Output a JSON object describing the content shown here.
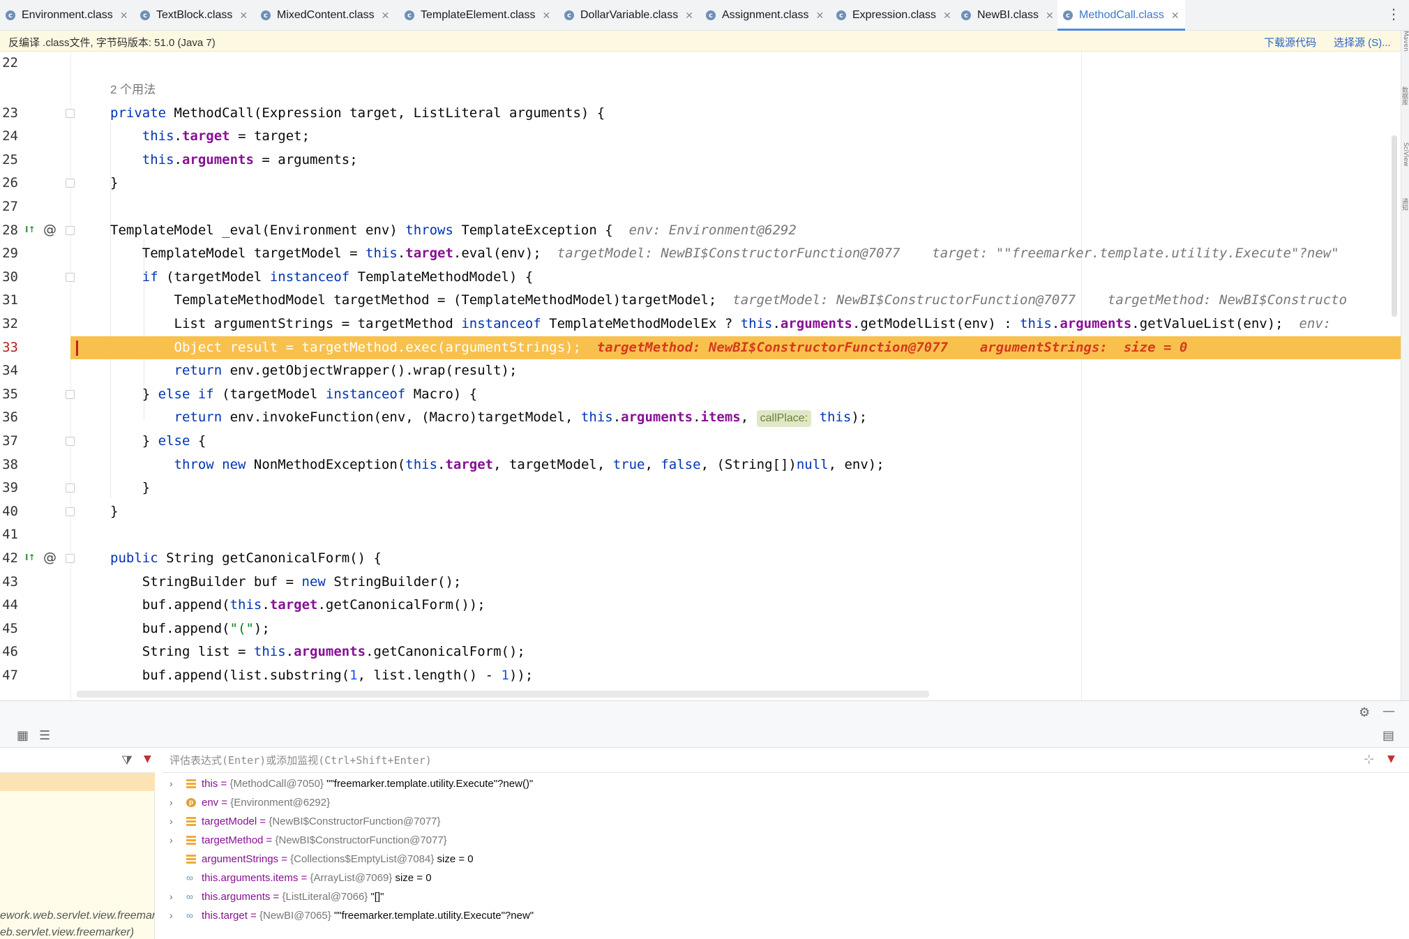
{
  "tabs": [
    {
      "label": "Environment.class",
      "active": false
    },
    {
      "label": "TextBlock.class",
      "active": false
    },
    {
      "label": "MixedContent.class",
      "active": false
    },
    {
      "label": "TemplateElement.class",
      "active": false
    },
    {
      "label": "DollarVariable.class",
      "active": false
    },
    {
      "label": "Assignment.class",
      "active": false
    },
    {
      "label": "Expression.class",
      "active": false
    },
    {
      "label": "NewBI.class",
      "active": false
    },
    {
      "label": "MethodCall.class",
      "active": true
    }
  ],
  "banner": {
    "message": "反编译 .class文件, 字节码版本: 51.0 (Java 7)",
    "download_label": "下载源代码",
    "choose_source_label": "选择源 (S)..."
  },
  "editor": {
    "usages": "2 个用法",
    "lines": [
      {
        "n": "22"
      },
      {
        "n": "23"
      },
      {
        "n": "24"
      },
      {
        "n": "25"
      },
      {
        "n": "26"
      },
      {
        "n": "27"
      },
      {
        "n": "28"
      },
      {
        "n": "29"
      },
      {
        "n": "30"
      },
      {
        "n": "31"
      },
      {
        "n": "32"
      },
      {
        "n": "33"
      },
      {
        "n": "34"
      },
      {
        "n": "35"
      },
      {
        "n": "36"
      },
      {
        "n": "37"
      },
      {
        "n": "38"
      },
      {
        "n": "39"
      },
      {
        "n": "40"
      },
      {
        "n": "41"
      },
      {
        "n": "42"
      },
      {
        "n": "43"
      },
      {
        "n": "44"
      },
      {
        "n": "45"
      },
      {
        "n": "46"
      },
      {
        "n": "47"
      }
    ],
    "current_line": "33",
    "inline_hints": {
      "l28": "env: Environment@6292",
      "l29": "targetModel: NewBI$ConstructorFunction@7077    target: \"\"freemarker.template.utility.Execute\"?new\"",
      "l31": "targetModel: NewBI$ConstructorFunction@7077    targetMethod: NewBI$Constructo",
      "l32": "env:",
      "l33": "targetMethod: NewBI$ConstructorFunction@7077    argumentStrings:  size = 0"
    },
    "param_hint": "callPlace:"
  },
  "debugger": {
    "eval_placeholder": "评估表达式(Enter)或添加监视(Ctrl+Shift+Enter)",
    "frames": [
      "ework.web.servlet.view.freemar",
      "eb.servlet.view.freemarker)"
    ],
    "variables": [
      {
        "expandable": true,
        "icon": "field-icon",
        "name": "this",
        "type": "{MethodCall@7050}",
        "value": "\"\"freemarker.template.utility.Execute\"?new()\""
      },
      {
        "expandable": true,
        "icon": "param-icon",
        "name": "env",
        "type": "{Environment@6292}",
        "value": ""
      },
      {
        "expandable": true,
        "icon": "field-icon",
        "name": "targetModel",
        "type": "{NewBI$ConstructorFunction@7077}",
        "value": ""
      },
      {
        "expandable": true,
        "icon": "field-icon",
        "name": "targetMethod",
        "type": "{NewBI$ConstructorFunction@7077}",
        "value": ""
      },
      {
        "expandable": false,
        "icon": "field-icon",
        "name": "argumentStrings",
        "type": "{Collections$EmptyList@7084}",
        "value": "size = 0"
      },
      {
        "expandable": false,
        "icon": "watch-icon",
        "name": "this.arguments.items",
        "type": "{ArrayList@7069}",
        "value": "size = 0"
      },
      {
        "expandable": true,
        "icon": "watch-icon",
        "name": "this.arguments",
        "type": "{ListLiteral@7066}",
        "value": "\"[]\""
      },
      {
        "expandable": true,
        "icon": "watch-icon",
        "name": "this.target",
        "type": "{NewBI@7065}",
        "value": "\"\"freemarker.template.utility.Execute\"?new\""
      }
    ]
  },
  "colors": {
    "keyword": "#0033b3",
    "field": "#871094",
    "current_line": "#f8c14d",
    "accent": "#4a8ae6"
  }
}
